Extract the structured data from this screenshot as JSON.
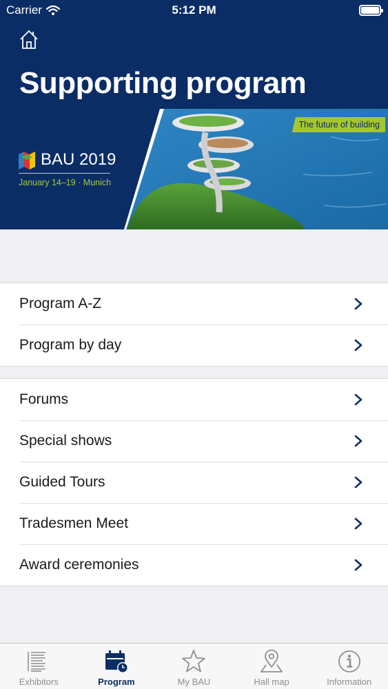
{
  "status_bar": {
    "carrier": "Carrier",
    "time": "5:12 PM"
  },
  "header": {
    "title": "Supporting program",
    "brand": "BAU 2019",
    "dates": "January 14–19 · Munich",
    "tagline": "The future of building"
  },
  "groups": [
    {
      "items": [
        {
          "label": "Program A-Z"
        },
        {
          "label": "Program by day"
        }
      ]
    },
    {
      "items": [
        {
          "label": "Forums"
        },
        {
          "label": "Special shows"
        },
        {
          "label": "Guided Tours"
        },
        {
          "label": "Tradesmen Meet"
        },
        {
          "label": "Award ceremonies"
        }
      ]
    }
  ],
  "tabs": [
    {
      "label": "Exhibitors",
      "icon": "list-icon"
    },
    {
      "label": "Program",
      "icon": "calendar-clock-icon",
      "active": true
    },
    {
      "label": "My BAU",
      "icon": "star-icon"
    },
    {
      "label": "Hall map",
      "icon": "map-pin-icon"
    },
    {
      "label": "Information",
      "icon": "info-icon"
    }
  ],
  "colors": {
    "navy": "#0b2d66",
    "green_accent": "#a6c531",
    "tab_inactive": "#8e8e93"
  }
}
